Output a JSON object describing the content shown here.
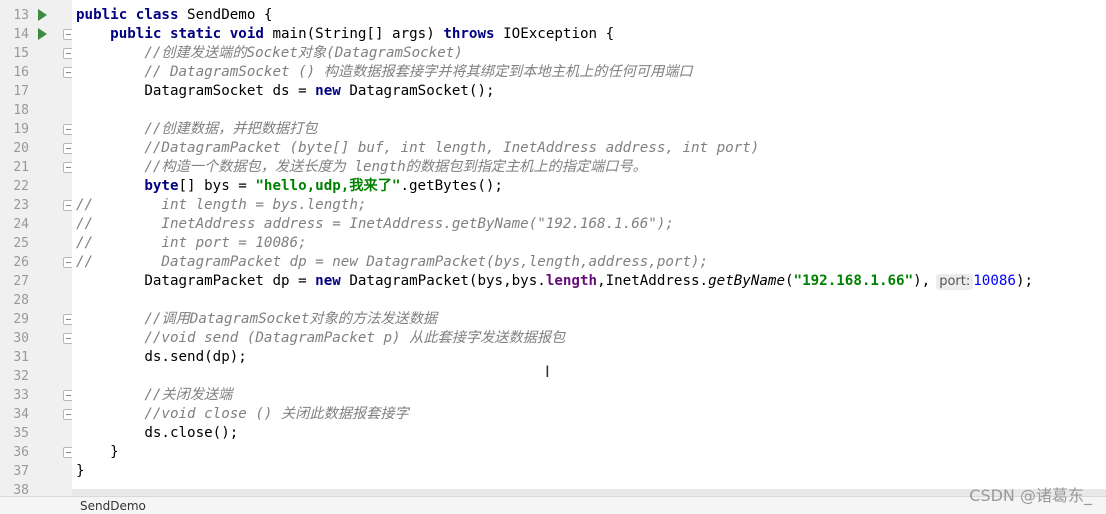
{
  "editor": {
    "lines": [
      {
        "n": "13",
        "parts": [
          [
            "kw",
            "public class "
          ],
          [
            "",
            "SendDemo {"
          ]
        ]
      },
      {
        "n": "14",
        "parts": [
          [
            "",
            "    "
          ],
          [
            "kw",
            "public static void "
          ],
          [
            "",
            "main(String[] args) "
          ],
          [
            "kw",
            "throws "
          ],
          [
            "",
            "IOException {"
          ]
        ]
      },
      {
        "n": "15",
        "parts": [
          [
            "",
            "        "
          ],
          [
            "cm",
            "//创建发送端的Socket对象(DatagramSocket)"
          ]
        ]
      },
      {
        "n": "16",
        "parts": [
          [
            "",
            "        "
          ],
          [
            "cm",
            "// DatagramSocket () 构造数据报套接字并将其绑定到本地主机上的任何可用端口"
          ]
        ]
      },
      {
        "n": "17",
        "parts": [
          [
            "",
            "        DatagramSocket ds = "
          ],
          [
            "kw",
            "new "
          ],
          [
            "",
            "DatagramSocket();"
          ]
        ]
      },
      {
        "n": "18",
        "parts": []
      },
      {
        "n": "19",
        "parts": [
          [
            "",
            "        "
          ],
          [
            "cm",
            "//创建数据，并把数据打包"
          ]
        ]
      },
      {
        "n": "20",
        "parts": [
          [
            "",
            "        "
          ],
          [
            "cm",
            "//DatagramPacket (byte[] buf, int length, InetAddress address, int port)"
          ]
        ]
      },
      {
        "n": "21",
        "parts": [
          [
            "",
            "        "
          ],
          [
            "cm",
            "//构造一个数据包，发送长度为 length的数据包到指定主机上的指定端口号。"
          ]
        ]
      },
      {
        "n": "22",
        "parts": [
          [
            "",
            "        "
          ],
          [
            "kw",
            "byte"
          ],
          [
            "",
            "[] bys = "
          ],
          [
            "str",
            "\"hello,udp,我来了\""
          ],
          [
            "",
            ".getBytes();"
          ]
        ]
      },
      {
        "n": "23",
        "parts": [
          [
            "cm",
            "//        int length = bys.length;"
          ]
        ]
      },
      {
        "n": "24",
        "parts": [
          [
            "cm",
            "//        InetAddress address = InetAddress.getByName(\"192.168.1.66\");"
          ]
        ]
      },
      {
        "n": "25",
        "parts": [
          [
            "cm",
            "//        int port = 10086;"
          ]
        ]
      },
      {
        "n": "26",
        "parts": [
          [
            "cm",
            "//        DatagramPacket dp = new DatagramPacket(bys,length,address,port);"
          ]
        ]
      },
      {
        "n": "27",
        "parts": [
          [
            "",
            "        DatagramPacket dp = "
          ],
          [
            "kw",
            "new "
          ],
          [
            "",
            "DatagramPacket(bys,bys."
          ],
          [
            "fld",
            "length"
          ],
          [
            "",
            ",InetAddress."
          ],
          [
            "sm",
            "getByName"
          ],
          [
            "",
            "("
          ],
          [
            "str",
            "\"192.168.1.66\""
          ],
          [
            "",
            "),"
          ],
          [
            "hint",
            "port:"
          ],
          [
            "num",
            "10086"
          ],
          [
            "",
            ");"
          ]
        ]
      },
      {
        "n": "28",
        "parts": []
      },
      {
        "n": "29",
        "parts": [
          [
            "",
            "        "
          ],
          [
            "cm",
            "//调用DatagramSocket对象的方法发送数据"
          ]
        ]
      },
      {
        "n": "30",
        "parts": [
          [
            "",
            "        "
          ],
          [
            "cm",
            "//void send (DatagramPacket p) 从此套接字发送数据报包"
          ]
        ]
      },
      {
        "n": "31",
        "parts": [
          [
            "",
            "        ds.send(dp);"
          ]
        ]
      },
      {
        "n": "32",
        "parts": []
      },
      {
        "n": "33",
        "parts": [
          [
            "",
            "        "
          ],
          [
            "cm",
            "//关闭发送端"
          ]
        ]
      },
      {
        "n": "34",
        "parts": [
          [
            "",
            "        "
          ],
          [
            "cm",
            "//void close () 关闭此数据报套接字"
          ]
        ]
      },
      {
        "n": "35",
        "parts": [
          [
            "",
            "        ds.close();"
          ]
        ]
      },
      {
        "n": "36",
        "parts": [
          [
            "",
            "    }"
          ]
        ]
      },
      {
        "n": "37",
        "parts": [
          [
            "",
            "}"
          ]
        ]
      },
      {
        "n": "38",
        "parts": []
      }
    ],
    "run_icon_lines": [
      "13",
      "14"
    ],
    "fold_icon_lines": [
      "14",
      "15",
      "16",
      "19",
      "20",
      "21",
      "23",
      "26",
      "29",
      "30",
      "33",
      "34",
      "36"
    ]
  },
  "status": {
    "file_tab": "SendDemo"
  },
  "watermark": "CSDN @诸葛东_",
  "colors": {
    "keyword": "#000080",
    "comment": "#808080",
    "string": "#008000",
    "field": "#660e7a",
    "number": "#0000ff",
    "run_icon": "#3e8a3e"
  }
}
